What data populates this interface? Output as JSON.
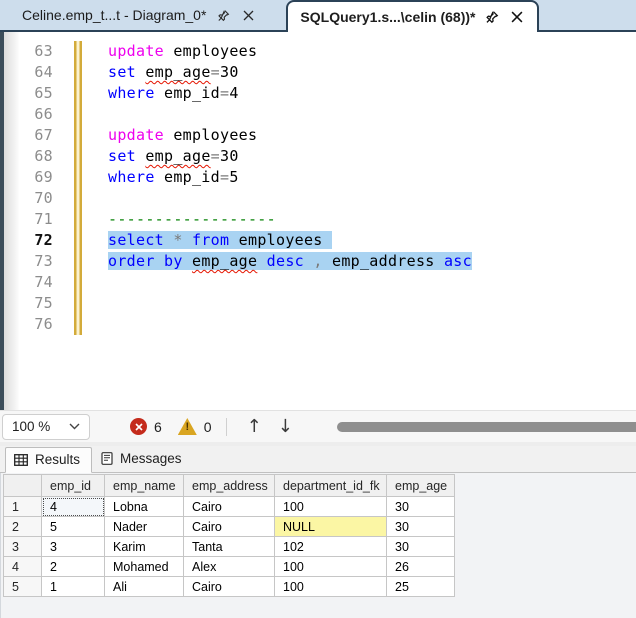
{
  "window": {
    "tabs": [
      {
        "title": "Celine.emp_t...t - Diagram_0*",
        "active": false
      },
      {
        "title": "SQLQuery1.s...\\celin (68))*",
        "active": true
      }
    ]
  },
  "editor": {
    "lines": [
      {
        "num": "63",
        "tokens": [
          [
            "stmt",
            "update"
          ],
          [
            "id",
            " employees"
          ]
        ]
      },
      {
        "num": "64",
        "tokens": [
          [
            "kw",
            "set"
          ],
          [
            "id",
            " "
          ],
          [
            "id-err",
            "emp_age"
          ],
          [
            "op",
            "="
          ],
          [
            "id",
            "30"
          ]
        ]
      },
      {
        "num": "65",
        "tokens": [
          [
            "kw",
            "where"
          ],
          [
            "id",
            " emp_id"
          ],
          [
            "op",
            "="
          ],
          [
            "id",
            "4"
          ]
        ]
      },
      {
        "num": "66",
        "tokens": []
      },
      {
        "num": "67",
        "tokens": [
          [
            "stmt",
            "update"
          ],
          [
            "id",
            " employees"
          ]
        ]
      },
      {
        "num": "68",
        "tokens": [
          [
            "kw",
            "set"
          ],
          [
            "id",
            " "
          ],
          [
            "id-err",
            "emp_age"
          ],
          [
            "op",
            "="
          ],
          [
            "id",
            "30"
          ]
        ]
      },
      {
        "num": "69",
        "tokens": [
          [
            "kw",
            "where"
          ],
          [
            "id",
            " emp_id"
          ],
          [
            "op",
            "="
          ],
          [
            "id",
            "5"
          ]
        ]
      },
      {
        "num": "70",
        "tokens": []
      },
      {
        "num": "71",
        "tokens": [
          [
            "cmt",
            "------------------"
          ]
        ]
      },
      {
        "num": "72",
        "cursor": true,
        "selected": true,
        "tokens": [
          [
            "kw",
            "select"
          ],
          [
            "op",
            " *"
          ],
          [
            "kw",
            " from"
          ],
          [
            "id",
            " employees"
          ],
          [
            "id",
            " "
          ]
        ]
      },
      {
        "num": "73",
        "selected": true,
        "tokens": [
          [
            "kw",
            "order by"
          ],
          [
            "id",
            " "
          ],
          [
            "id-err",
            "emp_age"
          ],
          [
            "kw",
            " desc"
          ],
          [
            "op",
            " ,"
          ],
          [
            "id",
            " emp_address"
          ],
          [
            "kw",
            " asc"
          ]
        ]
      },
      {
        "num": "74",
        "tokens": []
      },
      {
        "num": "75",
        "tokens": []
      },
      {
        "num": "76",
        "tokens": []
      }
    ]
  },
  "statusbar": {
    "zoom_level": "100 %",
    "error_count": "6",
    "warning_count": "0"
  },
  "results": {
    "tabs": [
      {
        "label": "Results",
        "active": true
      },
      {
        "label": "Messages",
        "active": false
      }
    ],
    "grid": {
      "columns": [
        "emp_id",
        "emp_name",
        "emp_address",
        "department_id_fk",
        "emp_age"
      ],
      "rows": [
        [
          "4",
          "Lobna",
          "Cairo",
          "100",
          "30"
        ],
        [
          "5",
          "Nader",
          "Cairo",
          "NULL",
          "30"
        ],
        [
          "3",
          "Karim",
          "Tanta",
          "102",
          "30"
        ],
        [
          "2",
          "Mohamed",
          "Alex",
          "100",
          "26"
        ],
        [
          "1",
          "Ali",
          "Cairo",
          "100",
          "25"
        ]
      ],
      "focused_cell": {
        "row": 0,
        "col": 0
      },
      "null_cell": {
        "row": 1,
        "col": 3
      }
    }
  },
  "colors": {
    "tabstrip_bg": "#cdddec",
    "active_tab_border": "#2b4257",
    "selection": "#a9d3f2",
    "keyword_blue": "#0000ff",
    "keyword_magenta": "#ee00ee",
    "comment_green": "#008000",
    "operator_gray": "#7a7a7a",
    "squiggle_red": "#e51400",
    "change_bar_gold": "#d3ab3a",
    "error_red": "#c42b1c",
    "warning_amber": "#d9a521",
    "null_cell_yellow": "#fbf6a4"
  }
}
